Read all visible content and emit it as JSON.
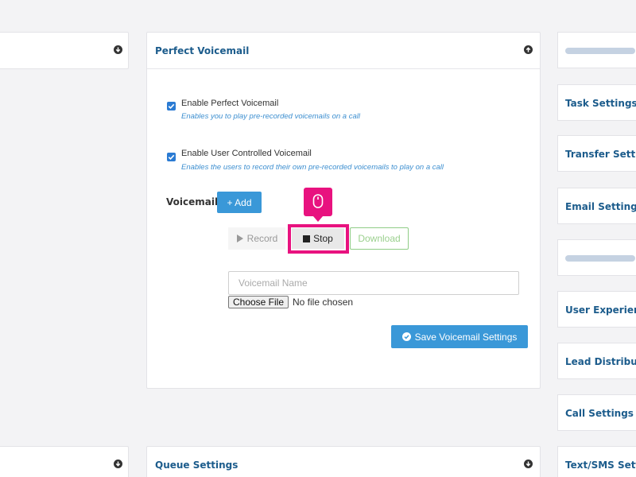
{
  "left_column": {
    "top_panel_icon": "circle-arrow-down-icon",
    "bottom_panel_icon": "circle-arrow-down-icon"
  },
  "voicemail_panel": {
    "title": "Perfect Voicemail",
    "collapse_icon": "circle-arrow-up-icon",
    "options": [
      {
        "label": "Enable Perfect Voicemail",
        "help": "Enables you to play pre-recorded voicemails on a call",
        "checked": true
      },
      {
        "label": "Enable User Controlled Voicemail",
        "help": "Enables the users to record their own pre-recorded voicemails to play on a call",
        "checked": true
      }
    ],
    "voicemails_label": "Voicemails",
    "add_label": "+ Add",
    "recorder": {
      "record_label": "Record",
      "record_icon": "play-icon",
      "stop_label": "Stop",
      "stop_icon": "stop-square-icon",
      "download_label": "Download"
    },
    "name_input": {
      "placeholder": "Voicemail Name",
      "value": ""
    },
    "file_input": {
      "button_label": "Choose File",
      "status": "No file chosen"
    },
    "save_label": "Save Voicemail Settings",
    "save_icon": "check-circle-icon"
  },
  "queue_panel": {
    "title": "Queue Settings",
    "expand_icon": "circle-arrow-down-icon"
  },
  "right_column": {
    "cards": [
      "",
      "Task Settings",
      "Transfer Setting",
      "Email Settings",
      "",
      "User Experience",
      "Lead Distributio",
      "Call Settings",
      "Text/SMS Setting"
    ]
  },
  "cursor_indicator_icon": "mouse-icon",
  "colors": {
    "accent": "#3a98d8",
    "title_blue": "#1c5c8c",
    "highlight": "#e8127f",
    "download_green": "#8fcd86"
  }
}
